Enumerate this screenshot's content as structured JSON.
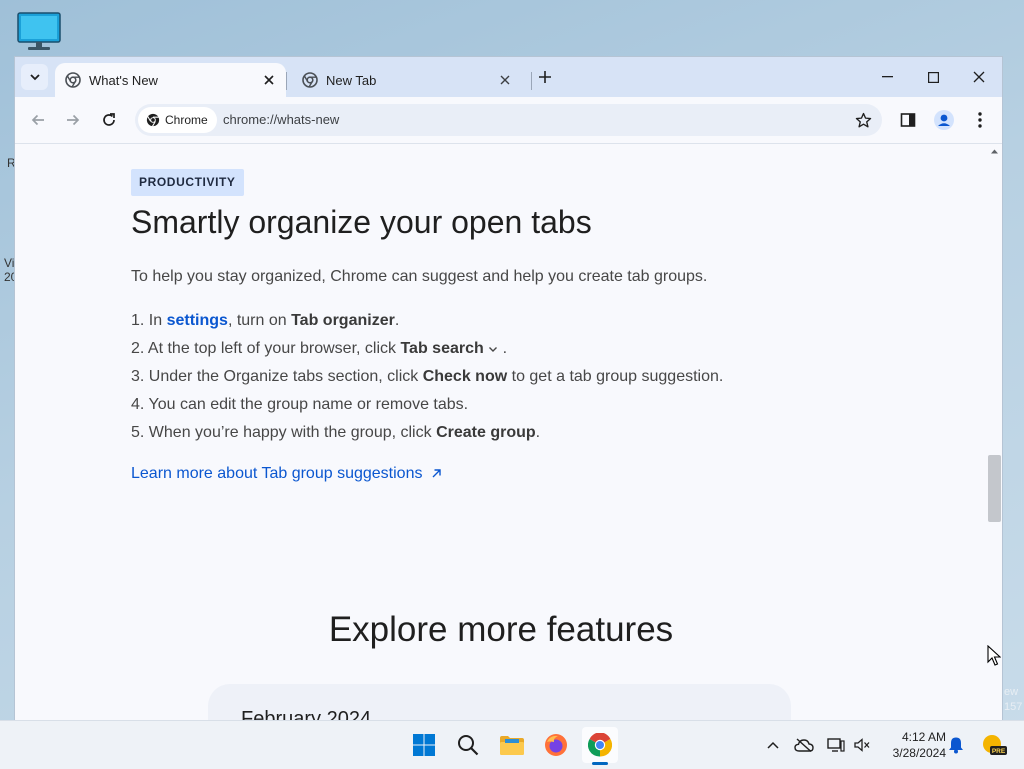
{
  "browser": {
    "tabs": [
      {
        "title": "What's New",
        "active": true
      },
      {
        "title": "New Tab",
        "active": false
      }
    ],
    "omnibox": {
      "chip_label": "Chrome",
      "url": "chrome://whats-new"
    }
  },
  "page": {
    "badge": "PRODUCTIVITY",
    "heading": "Smartly organize your open tabs",
    "intro": "To help you stay organized, Chrome can suggest and help you create tab groups.",
    "steps": [
      {
        "num": "1.",
        "parts": [
          "In ",
          "settings",
          ", turn on ",
          "Tab organizer",
          "."
        ]
      },
      {
        "num": "2.",
        "parts": [
          "At the top left of your browser, click ",
          "Tab search",
          " ."
        ]
      },
      {
        "num": "3.",
        "parts": [
          "Under the Organize tabs section, click ",
          "Check now",
          " to get a tab group suggestion."
        ]
      },
      {
        "num": "4.",
        "parts": [
          "You can edit the group name or remove tabs."
        ]
      },
      {
        "num": "5.",
        "parts": [
          "When you’re happy with the group, click ",
          "Create group",
          "."
        ]
      }
    ],
    "learn_more": "Learn more about Tab group suggestions",
    "explore_heading": "Explore more features",
    "card_title": "February 2024"
  },
  "desktop": {
    "edge_left": [
      "R",
      "Vi",
      "20"
    ],
    "edge_right": [
      "ew",
      "157"
    ]
  },
  "taskbar": {
    "time": "4:12 AM",
    "date": "3/28/2024",
    "weather_badge": "PRE"
  },
  "colors": {
    "link": "#0b57d0",
    "badge_bg": "#d3e3fd",
    "tabstrip": "#d7e3f6",
    "taskbar_indicator": "#0067c0"
  }
}
